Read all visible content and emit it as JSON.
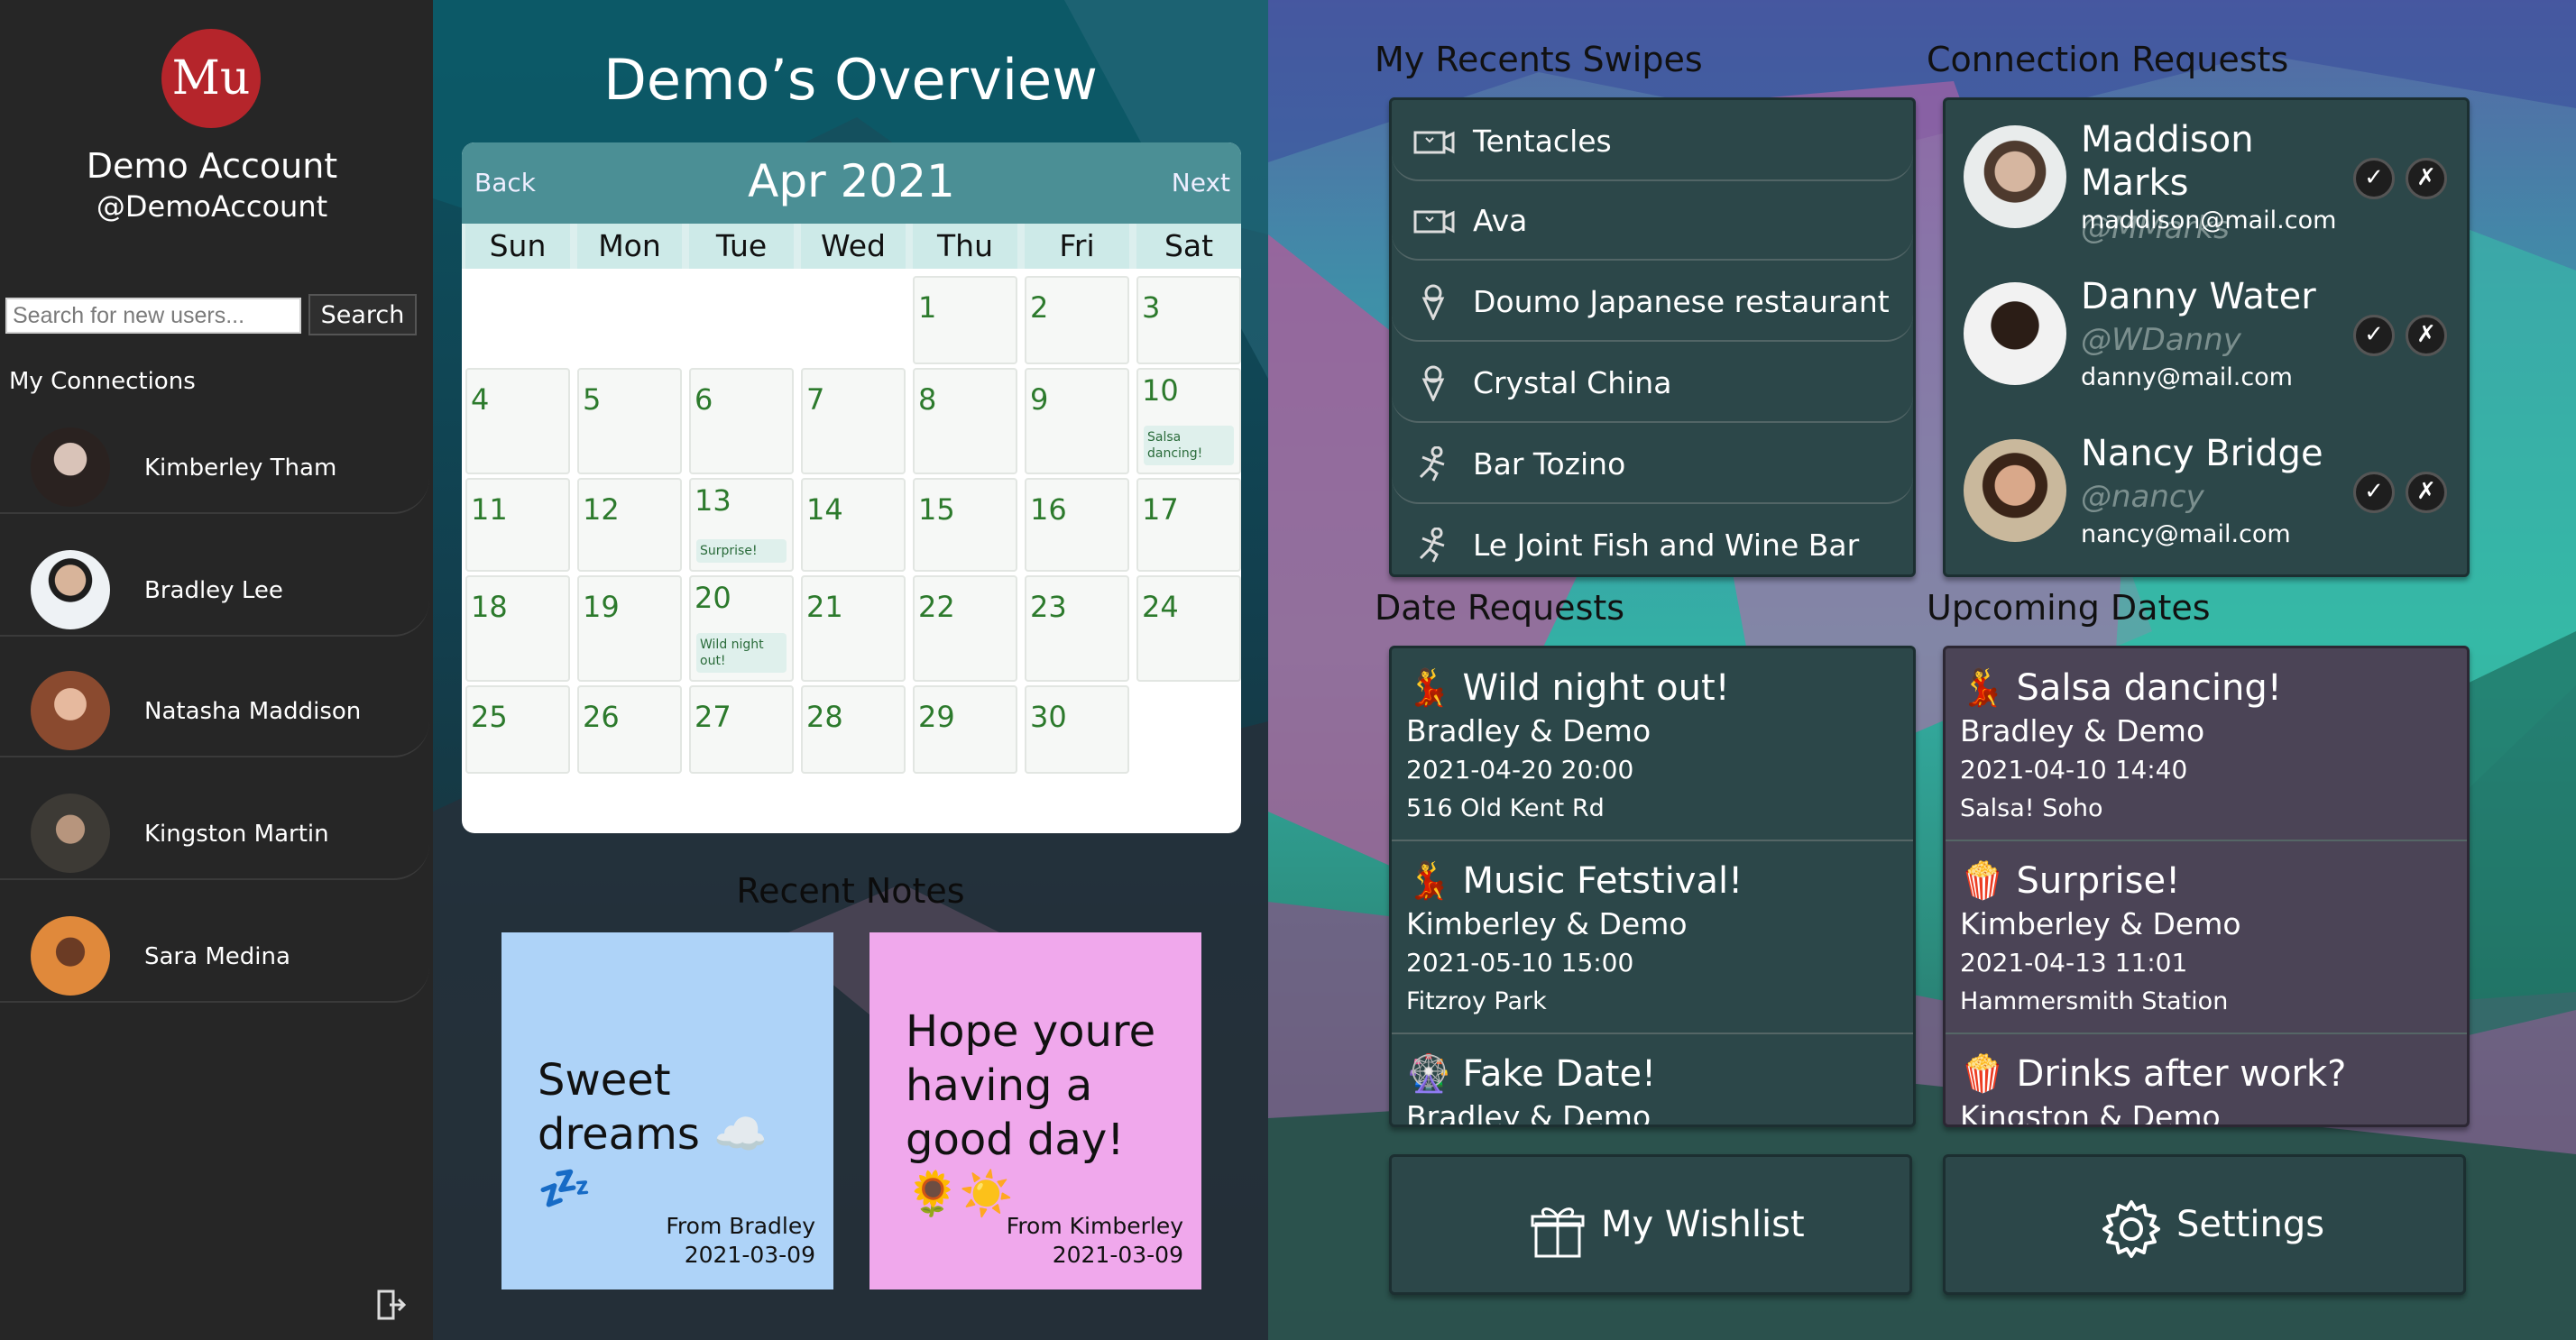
{
  "account": {
    "name": "Demo Account",
    "handle": "@DemoAccount",
    "logo_text": "Mu"
  },
  "search": {
    "placeholder": "Search for new users...",
    "button_label": "Search"
  },
  "connections": {
    "title": "My Connections",
    "items": [
      {
        "name": "Kimberley Tham"
      },
      {
        "name": "Bradley Lee"
      },
      {
        "name": "Natasha Maddison"
      },
      {
        "name": "Kingston Martin"
      },
      {
        "name": "Sara Medina"
      }
    ]
  },
  "overview_title": "Demo’s Overview",
  "calendar": {
    "month_label": "Apr 2021",
    "back_label": "Back",
    "next_label": "Next",
    "day_names": [
      "Sun",
      "Mon",
      "Tue",
      "Wed",
      "Thu",
      "Fri",
      "Sat"
    ],
    "days": [
      "1",
      "2",
      "3",
      "4",
      "5",
      "6",
      "7",
      "8",
      "9",
      "10",
      "11",
      "12",
      "13",
      "14",
      "15",
      "16",
      "17",
      "18",
      "19",
      "20",
      "21",
      "22",
      "23",
      "24",
      "25",
      "26",
      "27",
      "28",
      "29",
      "30"
    ],
    "events": [
      {
        "day": "10",
        "text": "Salsa dancing!"
      },
      {
        "day": "13",
        "text": "Surprise!"
      },
      {
        "day": "20",
        "text": "Wild night out!"
      }
    ]
  },
  "notes": {
    "title": "Recent Notes",
    "items": [
      {
        "text": "Sweet dreams ☁️💤",
        "from": "From Bradley",
        "date": "2021-03-09",
        "color": "#aed3f8"
      },
      {
        "text": "Hope youre having a good day! 🌻☀️",
        "from": "From Kimberley",
        "date": "2021-03-09",
        "color": "#f0a8ec"
      }
    ]
  },
  "swipes": {
    "title": "My Recents Swipes",
    "items": [
      {
        "label": "Tentacles",
        "icon": "movie-ticket-icon"
      },
      {
        "label": "Ava",
        "icon": "movie-ticket-icon"
      },
      {
        "label": "Doumo Japanese restaurant",
        "icon": "ice-cream-icon"
      },
      {
        "label": "Crystal China",
        "icon": "ice-cream-icon"
      },
      {
        "label": "Bar Tozino",
        "icon": "dancer-icon"
      },
      {
        "label": "Le Joint Fish and Wine Bar",
        "icon": "dancer-icon"
      }
    ]
  },
  "connection_requests": {
    "title": "Connection Requests",
    "items": [
      {
        "name": "Maddison Marks",
        "handle": "@MMarks",
        "email": "maddison@mail.com"
      },
      {
        "name": "Danny Water",
        "handle": "@WDanny",
        "email": "danny@mail.com"
      },
      {
        "name": "Nancy Bridge",
        "handle": "@nancy",
        "email": "nancy@mail.com"
      }
    ],
    "accept_symbol": "✓",
    "decline_symbol": "✗"
  },
  "date_requests": {
    "title": "Date Requests",
    "items": [
      {
        "emoji": "💃",
        "title": "Wild night out!",
        "who": "Bradley & Demo",
        "when": "2021-04-20 20:00",
        "where": "516 Old Kent Rd"
      },
      {
        "emoji": "💃",
        "title": "Music Fetstival!",
        "who": "Kimberley & Demo",
        "when": "2021-05-10 15:00",
        "where": "Fitzroy Park"
      },
      {
        "emoji": "🎡",
        "title": "Fake Date!",
        "who": "Bradley & Demo",
        "when": "",
        "where": ""
      }
    ]
  },
  "upcoming_dates": {
    "title": "Upcoming Dates",
    "items": [
      {
        "emoji": "💃",
        "title": "Salsa dancing!",
        "who": "Bradley & Demo",
        "when": "2021-04-10 14:40",
        "where": "Salsa! Soho"
      },
      {
        "emoji": "🍿",
        "title": "Surprise!",
        "who": "Kimberley & Demo",
        "when": "2021-04-13 11:01",
        "where": "Hammersmith Station"
      },
      {
        "emoji": "🍿",
        "title": "Drinks after work?",
        "who": "Kingston & Demo",
        "when": "",
        "where": ""
      }
    ]
  },
  "buttons": {
    "wishlist_label": "My Wishlist",
    "settings_label": "Settings"
  },
  "colors": {
    "brand_red": "#b5252b",
    "panel_teal": "#2c4749",
    "panel_purple": "#4b4456",
    "calendar_header": "#4b8f95"
  }
}
